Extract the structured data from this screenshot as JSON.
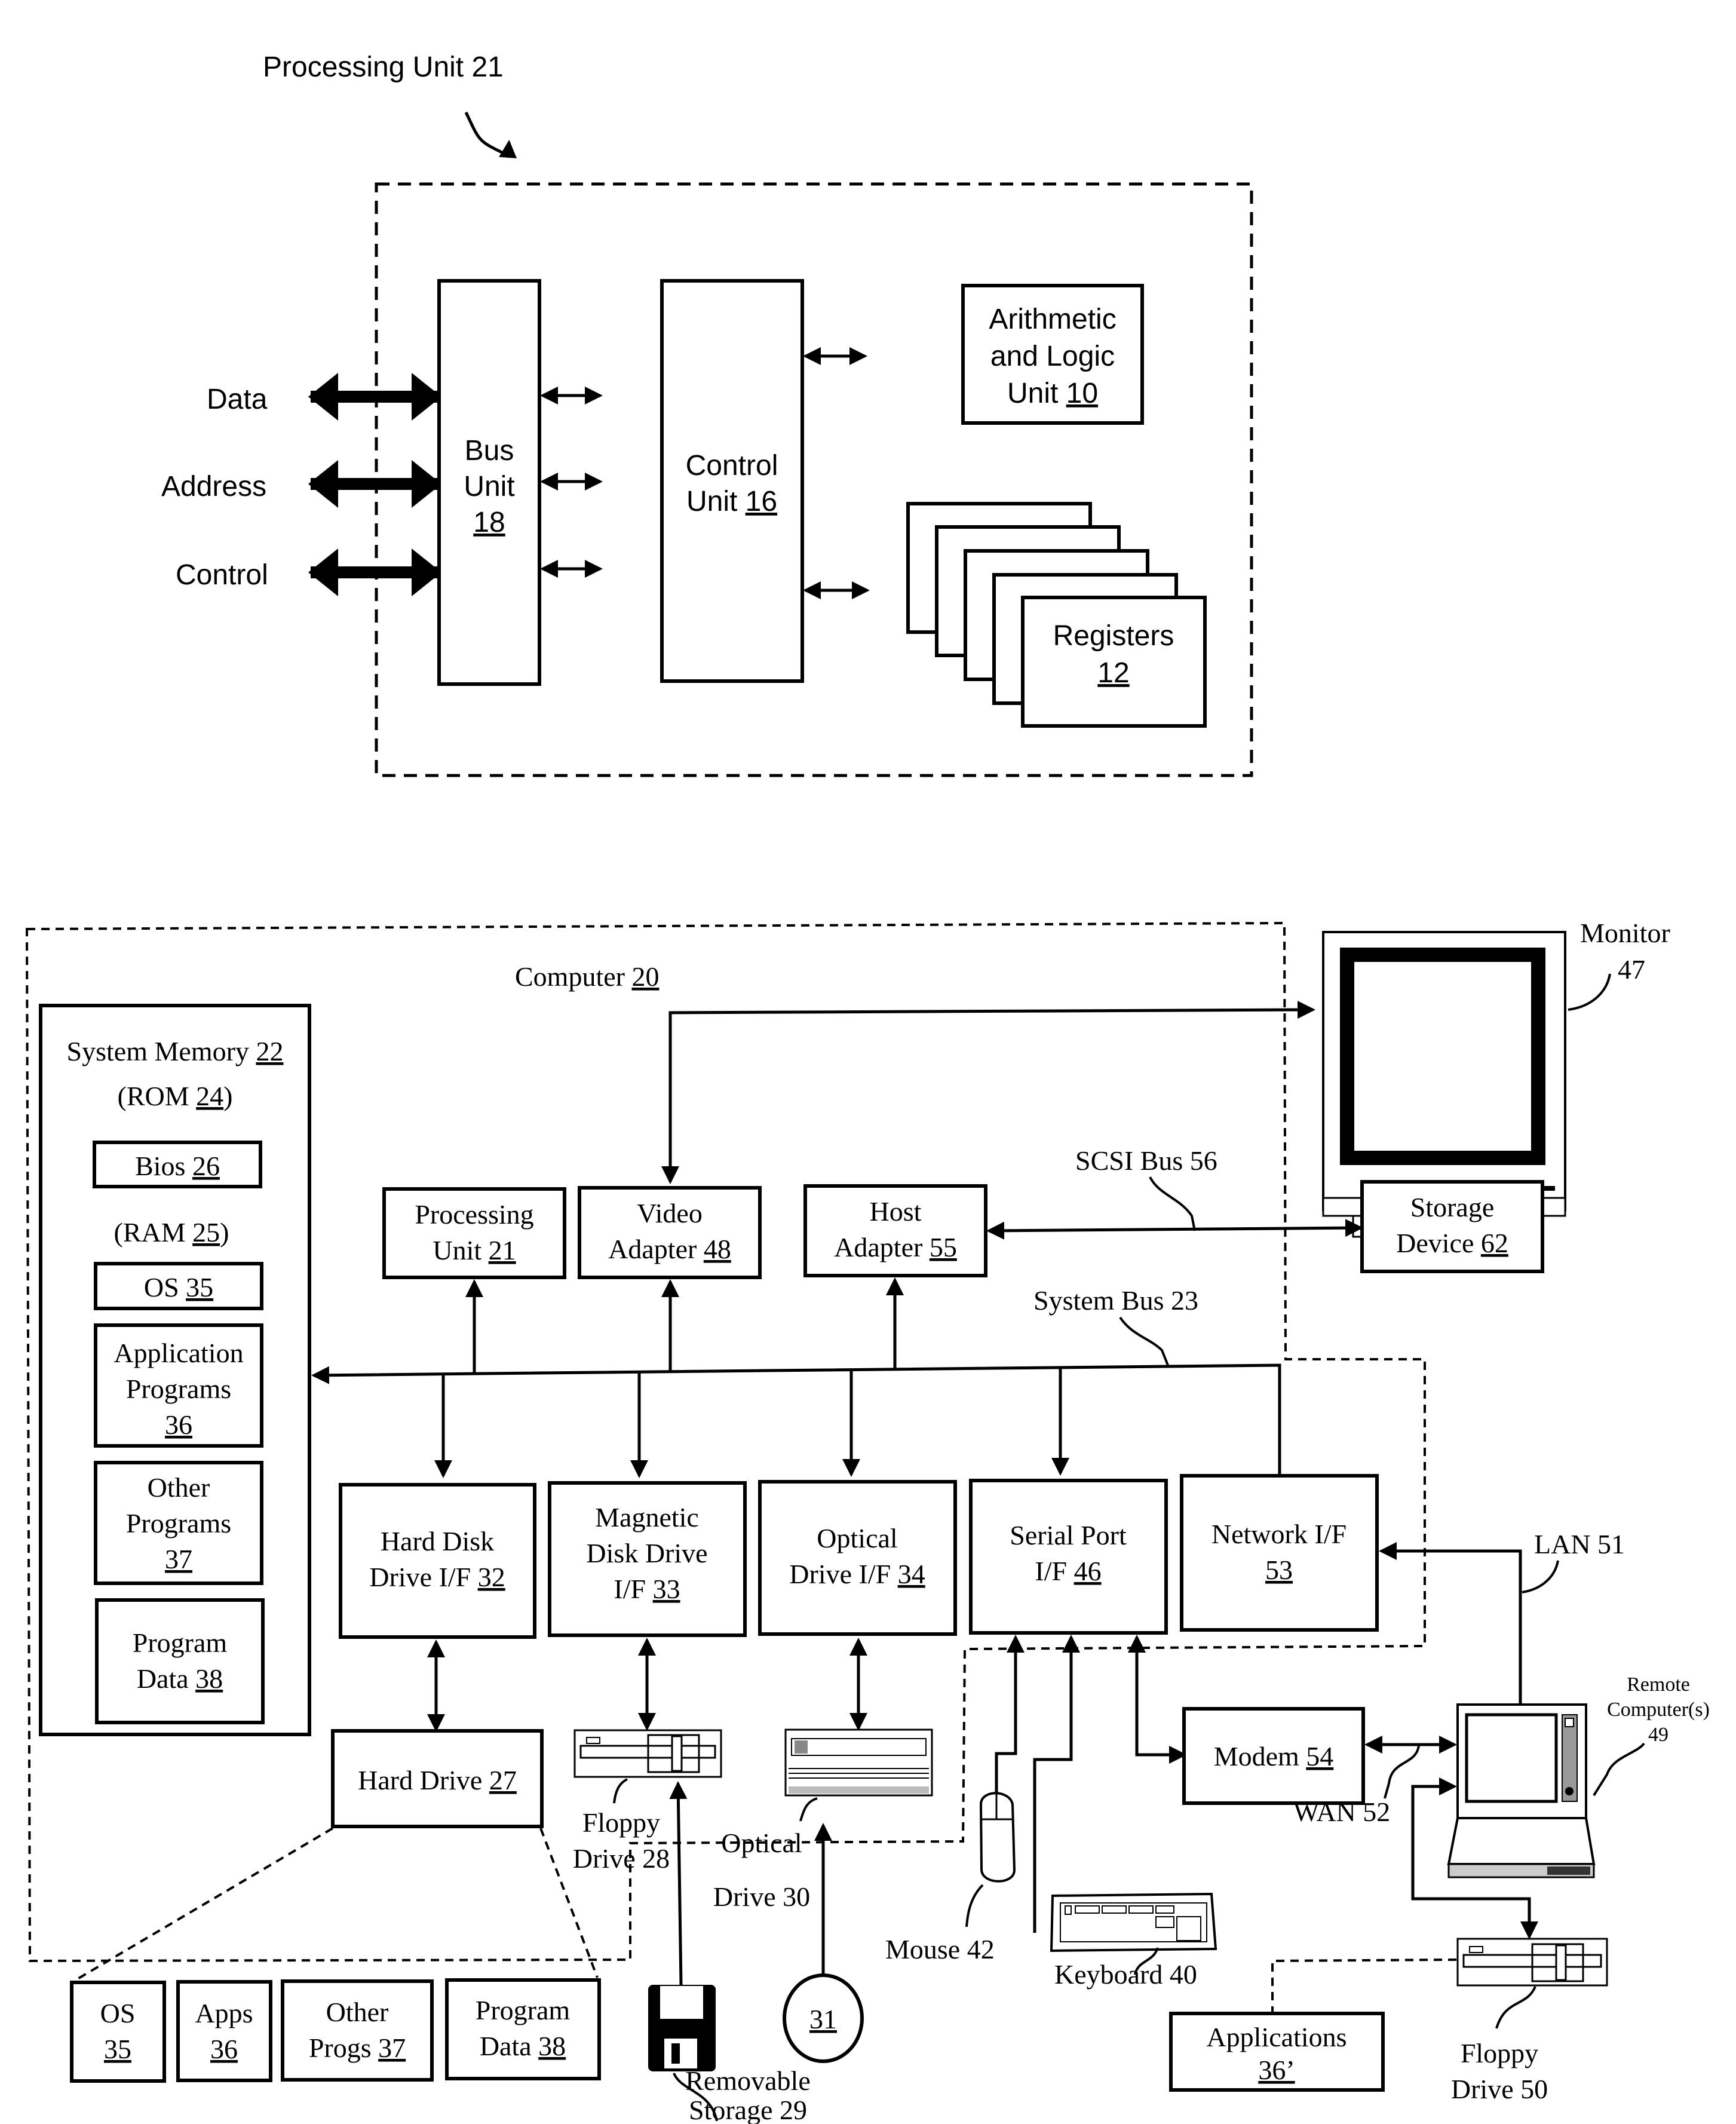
{
  "figure_a": {
    "title": "Processing Unit 21",
    "signals": [
      {
        "label": "Data"
      },
      {
        "label": "Address"
      },
      {
        "label": "Control"
      }
    ],
    "bus_unit": {
      "lines": [
        "Bus",
        "Unit"
      ],
      "ref": "18"
    },
    "control_unit": {
      "lines": [
        "Control"
      ],
      "prefix": "Unit ",
      "ref": "16"
    },
    "alu": {
      "lines": [
        "Arithmetic",
        "and Logic"
      ],
      "prefix": "Unit ",
      "ref": "10"
    },
    "registers": {
      "label": "Registers",
      "ref": "12"
    }
  },
  "figure_b": {
    "computer": {
      "label": "Computer ",
      "ref": "20"
    },
    "system_memory": {
      "label": "System Memory ",
      "ref": "22"
    },
    "rom": {
      "prefix": "(ROM ",
      "ref": "24",
      "suffix": ")"
    },
    "bios": {
      "label": "Bios ",
      "ref": "26"
    },
    "ram": {
      "prefix": "(RAM ",
      "ref": "25",
      "suffix": ")"
    },
    "os": {
      "label": "OS ",
      "ref": "35"
    },
    "app_programs": {
      "lines": [
        "Application",
        "Programs"
      ],
      "ref": "36"
    },
    "other_programs": {
      "lines": [
        "Other",
        "Programs"
      ],
      "ref": "37"
    },
    "program_data": {
      "line1": "Program",
      "line2": "Data ",
      "ref": "38"
    },
    "processing_unit": {
      "line1": "Processing",
      "line2": "Unit ",
      "ref": "21"
    },
    "video_adapter": {
      "line1": "Video",
      "line2": "Adapter ",
      "ref": "48"
    },
    "host_adapter": {
      "line1": "Host",
      "line2": "Adapter ",
      "ref": "55"
    },
    "monitor": {
      "line1": "Monitor",
      "line2": "47"
    },
    "scsi_bus": "SCSI Bus 56",
    "storage_device": {
      "line1": "Storage",
      "line2": "Device ",
      "ref": "62"
    },
    "system_bus": "System Bus 23",
    "hdd_if": {
      "line1": "Hard Disk",
      "line2": "Drive I/F ",
      "ref": "32"
    },
    "mdd_if": {
      "line1": "Magnetic",
      "line2": "Disk Drive",
      "line3": "I/F ",
      "ref": "33"
    },
    "optical_if": {
      "line1": "Optical",
      "line2": "Drive I/F ",
      "ref": "34"
    },
    "serial_if": {
      "line1": "Serial Port",
      "line2": "I/F ",
      "ref": "46"
    },
    "network_if": {
      "line1": "Network I/F",
      "ref": "53"
    },
    "hard_drive": {
      "label": "Hard Drive ",
      "ref": "27"
    },
    "floppy_drive": {
      "line1": "Floppy",
      "line2": "Drive 28"
    },
    "optical_drive": {
      "line1": "Optical",
      "line2": "Drive 30"
    },
    "modem": {
      "label": "Modem ",
      "ref": "54"
    },
    "lan": "LAN 51",
    "wan": "WAN 52",
    "remote_computer": {
      "line1": "Remote",
      "line2": "Computer(s)",
      "line3": "49"
    },
    "hd_contents": [
      {
        "line1": "OS",
        "ref": "35"
      },
      {
        "line1": "Apps",
        "ref": "36"
      },
      {
        "line1": "Other",
        "line2": "Progs ",
        "ref": "37"
      },
      {
        "line1": "Program",
        "line2": "Data ",
        "ref": "38"
      }
    ],
    "removable_storage": {
      "line1": "Removable",
      "line2": "Storage 29"
    },
    "optical_disc": {
      "ref": "31"
    },
    "mouse": "Mouse 42",
    "keyboard": "Keyboard 40",
    "applications": {
      "line1": "Applications",
      "ref": "36’"
    },
    "floppy_drive_50": {
      "line1": "Floppy",
      "line2": "Drive 50"
    }
  }
}
